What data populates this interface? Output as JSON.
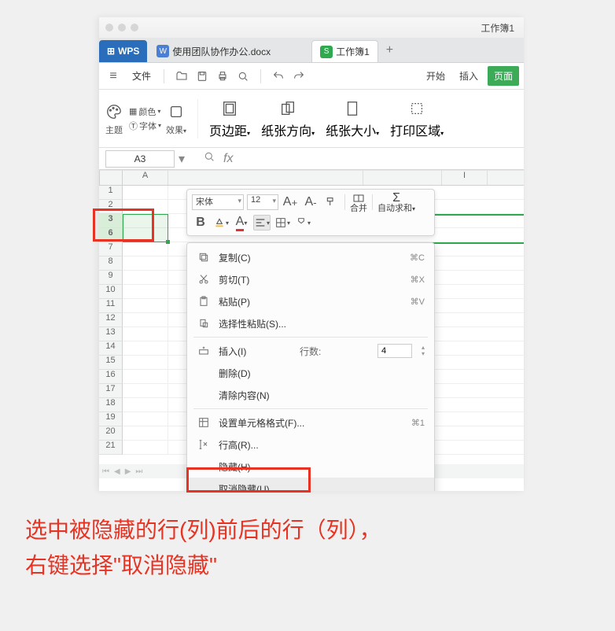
{
  "window": {
    "title": "工作簿1"
  },
  "tabs": {
    "wps": "WPS",
    "doc": {
      "badge": "W",
      "label": "使用团队协作办公.docx"
    },
    "sheet": {
      "badge": "S",
      "label": "工作簿1"
    }
  },
  "menubar": {
    "file": "文件",
    "items": [
      "开始",
      "插入"
    ],
    "page": "页面"
  },
  "ribbon": {
    "theme": "主题",
    "color": "颜色",
    "font": "字体",
    "effects": "效果",
    "margins": "页边距",
    "orientation": "纸张方向",
    "size": "纸张大小",
    "printarea": "打印区域"
  },
  "namebox": {
    "value": "A3"
  },
  "columns": [
    "A",
    "",
    "",
    "I"
  ],
  "rows": [
    "1",
    "2",
    "3",
    "6",
    "7",
    "8",
    "9",
    "10",
    "11",
    "12",
    "13",
    "14",
    "15",
    "16",
    "17",
    "18",
    "19",
    "20",
    "21"
  ],
  "minitool": {
    "font": "宋体",
    "size": "12",
    "merge": "合并",
    "autosum": "自动求和"
  },
  "ctx": {
    "copy": {
      "label": "复制(C)",
      "sc": "⌘C"
    },
    "cut": {
      "label": "剪切(T)",
      "sc": "⌘X"
    },
    "paste": {
      "label": "粘贴(P)",
      "sc": "⌘V"
    },
    "pastesp": {
      "label": "选择性粘贴(S)..."
    },
    "insert": {
      "label": "插入(I)",
      "rowslabel": "行数:",
      "rows": "4"
    },
    "delete": {
      "label": "删除(D)"
    },
    "clear": {
      "label": "清除内容(N)"
    },
    "format": {
      "label": "设置单元格格式(F)...",
      "sc": "⌘1"
    },
    "rowh": {
      "label": "行高(R)..."
    },
    "hide": {
      "label": "隐藏(H)"
    },
    "unhide": {
      "label": "取消隐藏(U)"
    }
  },
  "annotation": {
    "line1": "选中被隐藏的行(列)前后的行（列），",
    "line2": "右键选择\"取消隐藏\""
  }
}
